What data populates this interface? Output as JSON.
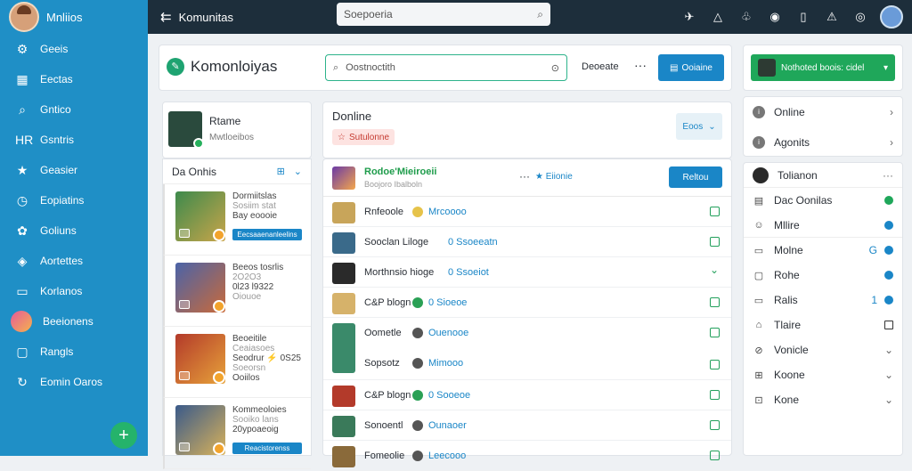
{
  "sidebar": {
    "title": "Mnliios",
    "items": [
      {
        "label": "Geeis",
        "icon": "gear-icon",
        "glyph": "⚙"
      },
      {
        "label": "Eectas",
        "icon": "chart-icon",
        "glyph": "▦"
      },
      {
        "label": "Gntico",
        "icon": "search-icon",
        "glyph": "⌕"
      },
      {
        "label": "Gsntris",
        "icon": "hr-icon",
        "glyph": "HR"
      },
      {
        "label": "Geasier",
        "icon": "star-icon",
        "glyph": "★"
      },
      {
        "label": "Eopiatins",
        "icon": "clock-icon",
        "glyph": "◷"
      },
      {
        "label": "Goliuns",
        "icon": "puzzle-icon",
        "glyph": "✿"
      },
      {
        "label": "Aortettes",
        "icon": "shield-icon",
        "glyph": "◈"
      },
      {
        "label": "Korlanos",
        "icon": "briefcase-icon",
        "glyph": "▭"
      },
      {
        "label": "Beeionens",
        "icon": "avatar-icon",
        "glyph": ""
      },
      {
        "label": "Rangls",
        "icon": "window-icon",
        "glyph": "▢"
      },
      {
        "label": "Eomin Oaros",
        "icon": "refresh-icon",
        "glyph": "↻"
      }
    ],
    "fab": "+"
  },
  "topbar": {
    "back": "⇇",
    "title": "Komunitas",
    "search_placeholder": "Soepoeria",
    "search_icon": "⌕",
    "icons": [
      {
        "name": "rocket-icon",
        "glyph": "✈",
        "dot": true
      },
      {
        "name": "bell-icon",
        "glyph": "△",
        "dot": false
      },
      {
        "name": "gift-icon",
        "glyph": "♧",
        "dot": true
      },
      {
        "name": "chrome-icon",
        "glyph": "◉",
        "dot": true
      },
      {
        "name": "phone-icon",
        "glyph": "▯",
        "dot": false
      },
      {
        "name": "alert-icon",
        "glyph": "⚠",
        "dot": true
      },
      {
        "name": "settings-icon",
        "glyph": "◎",
        "dot": false
      }
    ]
  },
  "header": {
    "title": "Komonloiyas",
    "search_placeholder": "Oostnoctith",
    "filter": "Deoeate",
    "more": "···",
    "button": "Ooiaine"
  },
  "right_top": {
    "button": "Nothoted boois: cidel"
  },
  "profile": {
    "name": "Rtame",
    "sub": "Mwtloeibos"
  },
  "left_list": {
    "title": "Da Onhis",
    "games": [
      {
        "lines": [
          "Dormiitslas",
          "Sosiim stat",
          "Bay eoooie"
        ],
        "tag": "Eecsaaenanleelins",
        "color1": "#3d8a4c",
        "color2": "#c9a54a"
      },
      {
        "lines": [
          "Beeos tosrlis",
          "2O2O3",
          "0l23 l9322",
          "Oiouoe"
        ],
        "tag": "",
        "color1": "#4a63a8",
        "color2": "#c96a3a"
      },
      {
        "lines": [
          "Beoeitile",
          "Ceaiasoes",
          "Seodrur ⚡ 0S25",
          "Soeorsn",
          "Ooiilos"
        ],
        "tag": "",
        "color1": "#b33a2a",
        "color2": "#e7a23a"
      },
      {
        "lines": [
          "Kommeoloies",
          "Sooiko lans",
          "20ypoaeoig"
        ],
        "tag": "Reacistorenss",
        "color1": "#3a5a8a",
        "color2": "#d9b25a"
      }
    ]
  },
  "online": {
    "title": "Donline",
    "tag": "Sutulonne",
    "tag_icon": "☆",
    "select": "Eoos"
  },
  "feed": {
    "header": {
      "title": "Rodoe'Mieiroeii",
      "sub": "Boojoro Ibalboln",
      "more": "···",
      "star": "★ Eiionie",
      "button": "Reltou"
    },
    "rows": [
      {
        "name": "Rnfeoole",
        "status": "Mrcoooo",
        "icon_color": "#e6c34a",
        "action": "check",
        "img": "#c8a55a"
      },
      {
        "name": "Sooclan Liloge",
        "status": "0 Ssoeeatn",
        "icon_color": "",
        "action": "check",
        "img": "#3a6a8a"
      },
      {
        "name": "Morthnsio hioge",
        "status": "0 Ssoeiot",
        "icon_color": "",
        "action": "chevron",
        "img": "#2a2a2a"
      },
      {
        "name": "C&P blogn",
        "status": "0 Sioeoe",
        "icon_color": "#2aa055",
        "action": "check",
        "img": "#d6b26a"
      },
      {
        "name": "Oometle",
        "status": "Ouenooe",
        "icon_color": "#555",
        "action": "check",
        "img": "#3a8a6a",
        "second": {
          "name": "Sopsotz",
          "status": "Mimooo"
        }
      },
      {
        "name": "C&P blogn",
        "status": "0 Sooeoe",
        "icon_color": "#2aa055",
        "action": "check",
        "img": "#b33a2a"
      },
      {
        "name": "Sonoentl",
        "status": "Ounaoer",
        "icon_color": "#555",
        "action": "check",
        "img": "#3a7a5a"
      },
      {
        "name": "Fomeolie",
        "status": "Leecooo",
        "icon_color": "#555",
        "action": "check",
        "img": "#8a6a3a"
      }
    ]
  },
  "right_panel": {
    "top": [
      {
        "label": "Online",
        "end": "›"
      },
      {
        "label": "Agonits",
        "end": "›"
      }
    ],
    "items": [
      {
        "label": "Tolianon",
        "end": "···",
        "kind": "avatar",
        "glyph": ""
      },
      {
        "label": "Dac Oonilas",
        "end": "",
        "kind": "gr",
        "glyph": "▤"
      },
      {
        "label": "Mllire",
        "end": "",
        "kind": "bl",
        "glyph": "☺"
      },
      {
        "label": "Molne",
        "end": "G",
        "kind": "bl",
        "glyph": "▭"
      },
      {
        "label": "Rohe",
        "end": "",
        "kind": "bl",
        "glyph": "▢"
      },
      {
        "label": "Ralis",
        "end": "1",
        "kind": "bl",
        "glyph": "▭"
      },
      {
        "label": "Tlaire",
        "end": "",
        "kind": "sq",
        "glyph": "⌂"
      },
      {
        "label": "Vonicle",
        "end": "⌄",
        "kind": "",
        "glyph": "⊘"
      },
      {
        "label": "Koone",
        "end": "⌄",
        "kind": "",
        "glyph": "⊞"
      },
      {
        "label": "Kone",
        "end": "⌄",
        "kind": "",
        "glyph": "⊡"
      }
    ]
  }
}
